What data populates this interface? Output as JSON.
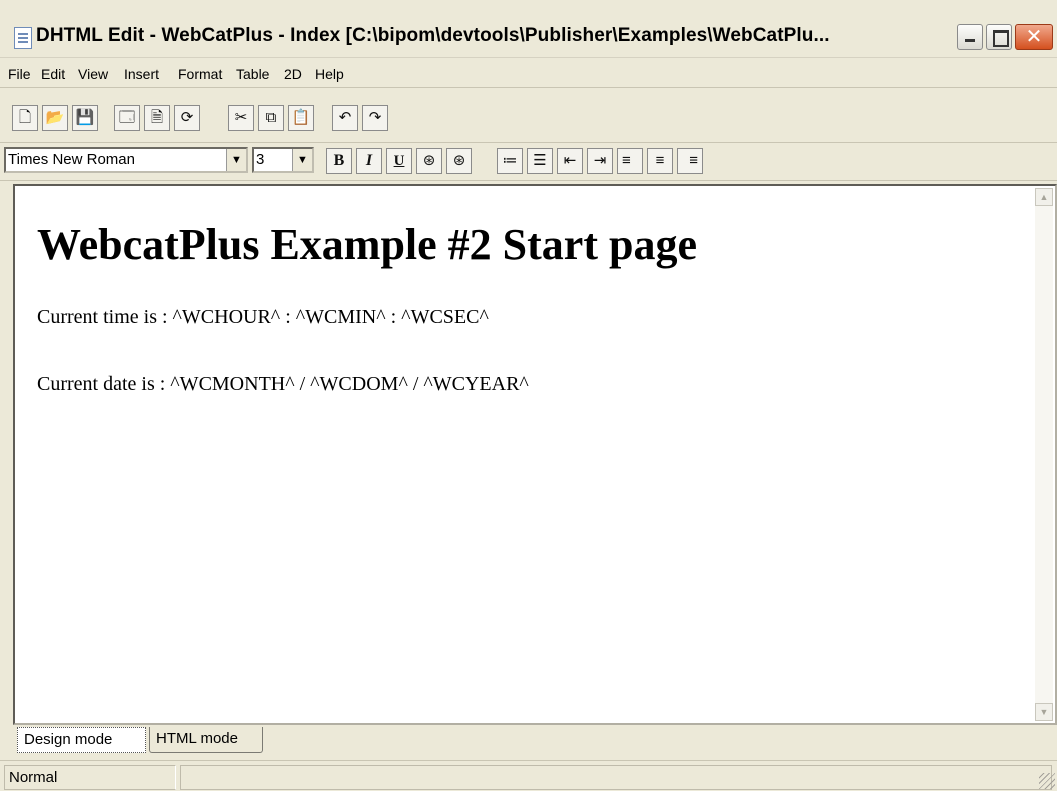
{
  "window": {
    "title": "DHTML Edit - WebCatPlus - Index [C:\\bipom\\devtools\\Publisher\\Examples\\WebCatPlu...",
    "close_glyph": "✕"
  },
  "menu": [
    "File",
    "Edit",
    "View",
    "Insert",
    "Format",
    "Table",
    "2D",
    "Help"
  ],
  "toolbar1": {
    "icons": [
      "new-icon",
      "open-icon",
      "save-icon",
      "properties-icon",
      "document-icon",
      "refresh-icon",
      "cut-icon",
      "copy-icon",
      "paste-icon",
      "undo-icon",
      "redo-icon"
    ],
    "glyphs": [
      "🗋",
      "📂",
      "💾",
      "🗔",
      "🗎",
      "⟳",
      "✂",
      "⧉",
      "📋",
      "↶",
      "↷"
    ]
  },
  "toolbar2": {
    "font_name": "Times New Roman",
    "font_size": "3",
    "bold": "B",
    "italic": "I",
    "underline": "U",
    "fg_color_glyph": "⊛",
    "bg_color_glyph": "⊛",
    "numbered_list_glyph": "≔",
    "bullet_list_glyph": "☰",
    "outdent_glyph": "⇤",
    "indent_glyph": "⇥",
    "align_left_glyph": "≡",
    "align_center_glyph": "≡",
    "align_right_glyph": "≡"
  },
  "document": {
    "heading": "WebcatPlus Example #2 Start page",
    "line1": "Current time is : ^WCHOUR^ : ^WCMIN^ : ^WCSEC^",
    "line2": "Current date is : ^WCMONTH^ / ^WCDOM^ / ^WCYEAR^"
  },
  "scroll": {
    "up": "▲",
    "down": "▼"
  },
  "tabs": {
    "design": "Design mode",
    "html": "HTML mode"
  },
  "status": {
    "style": "Normal"
  }
}
